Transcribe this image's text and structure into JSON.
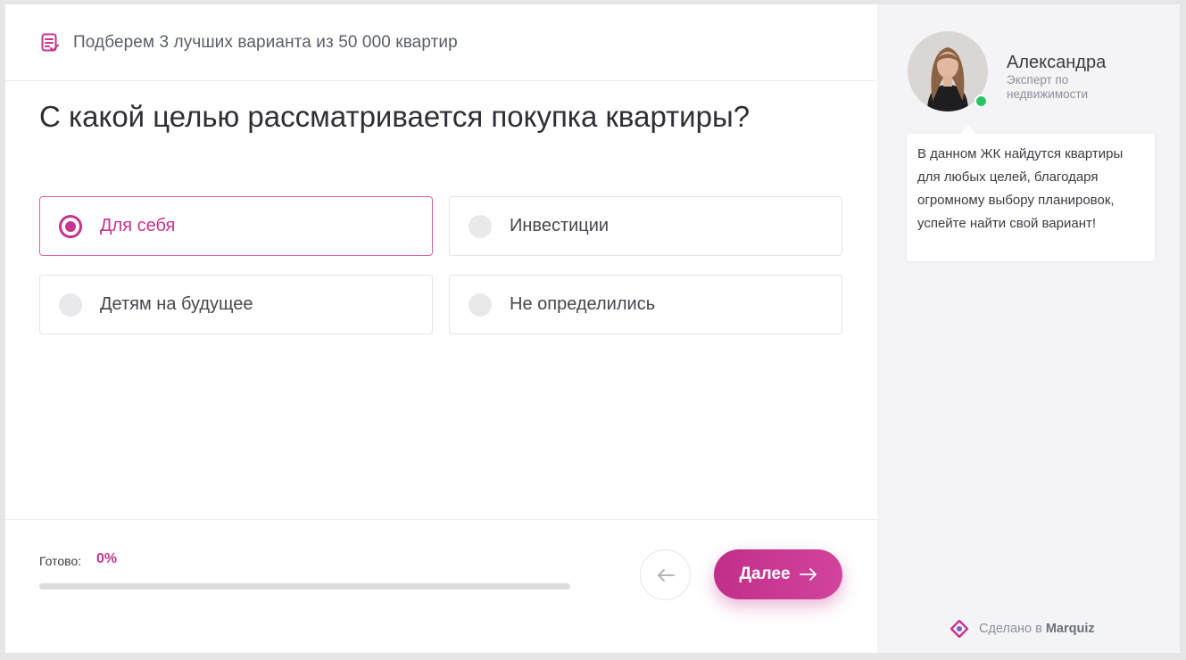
{
  "header": {
    "text": "Подберем 3 лучших варианта из 50 000 квартир",
    "icon": "checklist-icon"
  },
  "question": {
    "title": "С какой целью рассматривается покупка квартиры?"
  },
  "options": [
    {
      "label": "Для себя",
      "selected": true
    },
    {
      "label": "Инвестиции",
      "selected": false
    },
    {
      "label": "Детям на будущее",
      "selected": false
    },
    {
      "label": "Не определились",
      "selected": false
    }
  ],
  "footer": {
    "progress_label": "Готово:",
    "progress_value": "0%",
    "progress_fraction": 0,
    "back_icon": "arrow-left-icon",
    "next_label": "Далее",
    "next_icon": "arrow-right-icon"
  },
  "expert": {
    "name": "Александра",
    "role": "Эксперт по недвижимости",
    "online": true,
    "message": "В данном ЖК найдутся квартиры для любых целей, благодаря огромному выбору планировок, успейте найти свой вариант!"
  },
  "branding": {
    "prefix": "Сделано в",
    "brand": "Marquiz",
    "icon": "marquiz-logo-icon"
  },
  "colors": {
    "accent": "#c7338f",
    "online": "#2ec364",
    "sidebar_bg": "#f4f4f6"
  }
}
